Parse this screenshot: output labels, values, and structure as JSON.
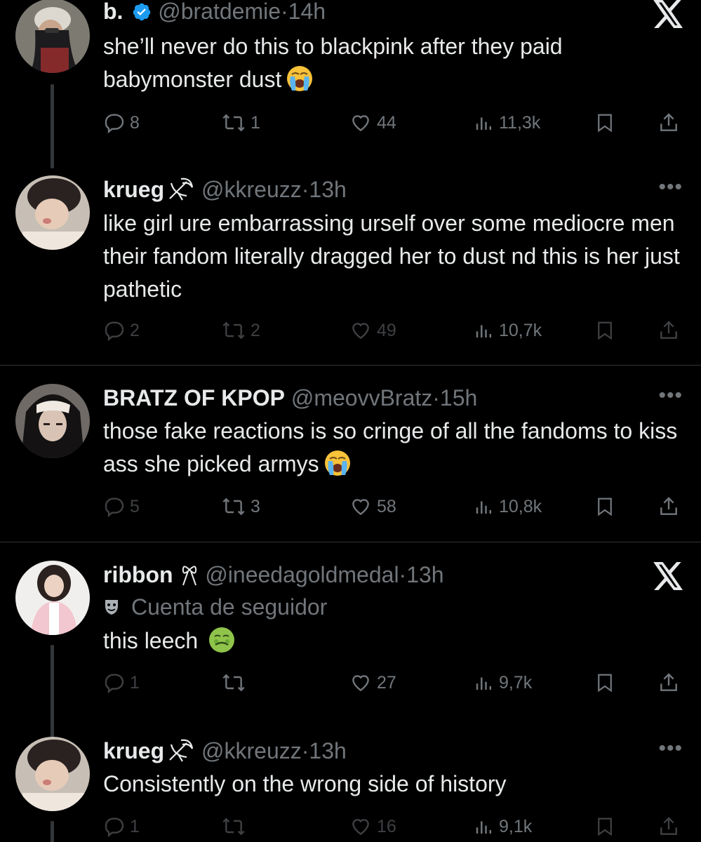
{
  "tweets": [
    {
      "name": "b.",
      "handle": "@bratdemie",
      "dot": "·",
      "time": "14h",
      "verified": true,
      "text": "she’ll never do this to blackpink after they paid babymonster dust",
      "emoji": "loudly-crying-face",
      "replies": "8",
      "retweets": "1",
      "likes": "44",
      "views": "11,3k",
      "corner": "x-logo"
    },
    {
      "name": "krueg",
      "handle": "@kkreuzz",
      "dot": "·",
      "time": "13h",
      "text": "like girl ure embarrassing urself over some mediocre men their fandom literally dragged her to dust nd this is her just pathetic",
      "replies": "2",
      "retweets": "2",
      "likes": "49",
      "views": "10,7k",
      "corner": "more"
    },
    {
      "name": "BRATZ OF KPOP",
      "handle": "@meovvBratz",
      "dot": "·",
      "time": "15h",
      "text": "those fake reactions is so cringe of all the fandoms to kiss ass she picked armys",
      "emoji": "loudly-crying-face",
      "replies": "5",
      "retweets": "3",
      "likes": "58",
      "views": "10,8k",
      "corner": "more"
    },
    {
      "name": "ribbon",
      "handle": "@ineedagoldmedal",
      "dot": "·",
      "time": "13h",
      "follower_label": "Cuenta de seguidor",
      "text": "this leech",
      "emoji": "nauseated-face",
      "replies": "1",
      "retweets": "",
      "likes": "27",
      "views": "9,7k",
      "corner": "x-logo"
    },
    {
      "name": "krueg",
      "handle": "@kkreuzz",
      "dot": "·",
      "time": "13h",
      "text": "Consistently on the wrong side of history",
      "replies": "1",
      "retweets": "",
      "likes": "16",
      "views": "9,1k",
      "corner": "more"
    }
  ],
  "more_label": "•••",
  "colors": {
    "background": "#000000",
    "text": "#e7e9ea",
    "muted": "#71767b",
    "verified": "#1d9bf0",
    "divider": "#2f3336"
  }
}
